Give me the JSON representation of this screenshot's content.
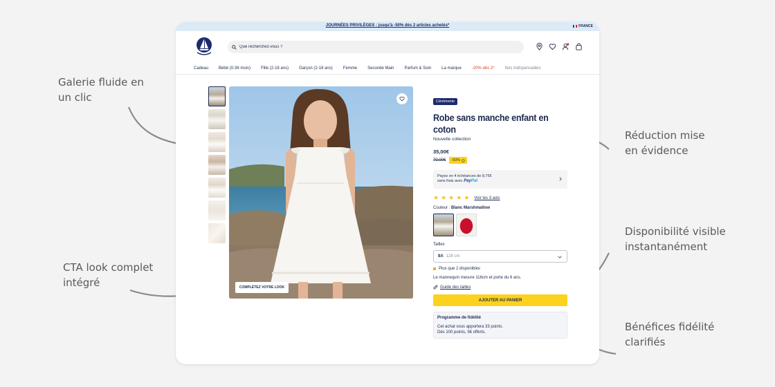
{
  "annotations": [
    {
      "line1": "Galerie fluide en",
      "line2": "un clic"
    },
    {
      "line1": "CTA look complet",
      "line2": "intégré"
    },
    {
      "line1": "Réduction mise",
      "line2": "en évidence"
    },
    {
      "line1": "Disponibilité visible",
      "line2": "instantanément"
    },
    {
      "line1": "Bénéfices fidélité",
      "line2": "clarifiés"
    }
  ],
  "promo": {
    "text": "JOURNÉES PRIVILÈGES : jusqu'à -50% dès 2 articles achetés*",
    "country": "FRANCE"
  },
  "header": {
    "logo_text": "PETIT BATEAU",
    "search_placeholder": "Que recherchez-vous ?",
    "icons": [
      "location-icon",
      "heart-icon",
      "user-icon",
      "bag-icon"
    ]
  },
  "nav": [
    "Cadeau",
    "Bébé (0-36 mois)",
    "Fille (2-18 ans)",
    "Garçon (2-18 ans)",
    "Femme",
    "Seconde Main",
    "Parfum & Soin",
    "La marque",
    "-20% dès 2*",
    "Nos indispensables"
  ],
  "gallery": {
    "look_button": "COMPLÉTEZ VOTRE LOOK"
  },
  "product": {
    "tag": "Cérémonie",
    "title": "Robe sans manche enfant en coton",
    "subtitle": "Nouvelle collection",
    "price": "35,00€",
    "old_price": "70,00€",
    "discount": "-50%",
    "paypal_line1": "Payez en 4 échéances de 8,75€",
    "paypal_line2": "sans frais avec",
    "paypal_brand_a": "Pay",
    "paypal_brand_b": "Pal",
    "rating": 5,
    "reviews": "Voir les 3 avis",
    "color_label": "Couleur :",
    "color_value": "Blanc Marshmallow",
    "sizes_label": "Tailles",
    "size_selected": "8A",
    "size_cm": "128 cm",
    "stock": "Plus que 2 disponibles",
    "model_info": "Le mannequin mesure 116cm et porte du 6 ans.",
    "size_guide": "Guide des tailles",
    "cart_button": "AJOUTER AU PANIER",
    "loyalty_title": "Programme de fidélité",
    "loyalty_line1": "Cet achat vous apportera 33 points.",
    "loyalty_line2": "Dès 100 points, 5€ offerts."
  },
  "colors": {
    "navy": "#1d2a4d",
    "yellow": "#fdd21f",
    "promo_bg": "#dceaf6",
    "annotation": "#595959"
  }
}
